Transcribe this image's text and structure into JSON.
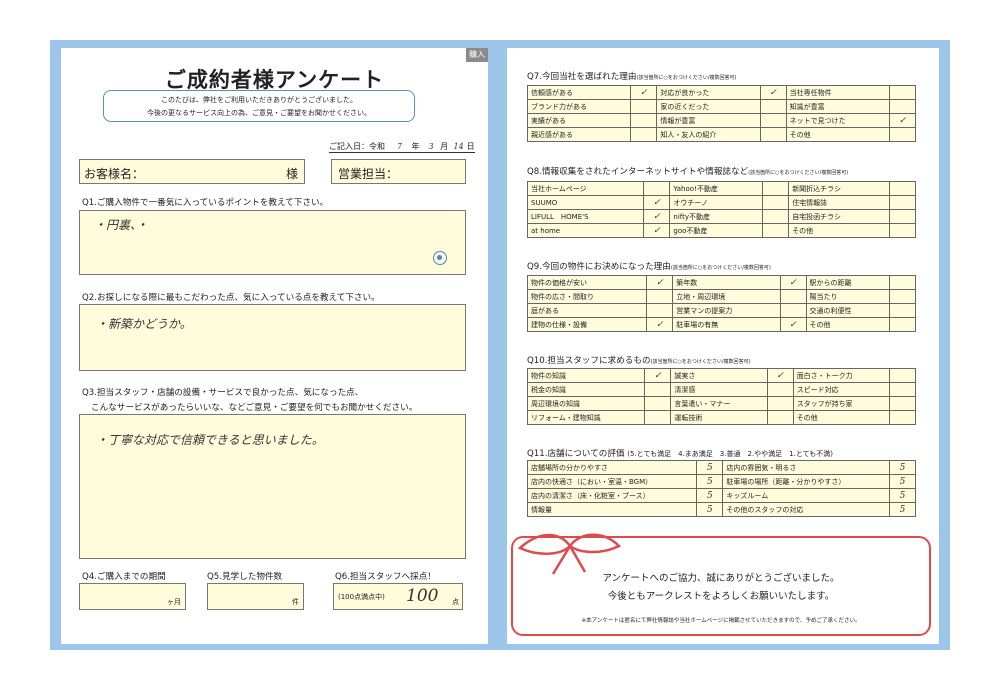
{
  "left": {
    "tag": "購入",
    "title": "ご成約者様アンケート",
    "intro_line1": "このたびは、弊社をご利用いただきありがとうございました。",
    "intro_line2": "今後の更なるサービス向上の為、ご意見・ご要望をお聞かせください。",
    "date_label": "ご記入日：令和",
    "date_year": "7",
    "date_year_unit": "年",
    "date_month": "3",
    "date_month_unit": "月",
    "date_day": "14",
    "date_day_unit": "日",
    "customer_label": "お客様名：",
    "customer_suffix": "様",
    "staff_label": "営業担当：",
    "q1": "Q1.ご購入物件で一番気に入っているポイントを教えて下さい。",
    "q1_answer": "・円裏、・",
    "q2": "Q2.お探しになる際に最もこだわった点、気に入っている点を教えて下さい。",
    "q2_answer": "・新築かどうか。",
    "q3_line1": "Q3.担当スタッフ・店舗の設備・サービスで良かった点、気になった点、",
    "q3_line2": "こんなサービスがあったらいいな、などご意見・ご要望を何でもお聞かせください。",
    "q3_answer": "・丁寧な対応で信頼できると思いました。",
    "q4": "Q4.ご購入までの期間",
    "q4_unit": "ヶ月",
    "q5": "Q5.見学した物件数",
    "q5_unit": "件",
    "q6": "Q6.担当スタッフへ採点！",
    "q6_prefix": "(100点満点中)",
    "q6_score": "100",
    "q6_unit": "点"
  },
  "right": {
    "q7": "Q7.今回当社を選ばれた理由",
    "q7_note": "(該当箇所に○をおつけください/複数回答可)",
    "q7_rows": [
      [
        "信頼感がある",
        "✓",
        "対応が良かった",
        "✓",
        "当社専任物件",
        ""
      ],
      [
        "ブランド力がある",
        "",
        "家の近くだった",
        "",
        "知識が豊富",
        ""
      ],
      [
        "実績がある",
        "",
        "情報が豊富",
        "",
        "ネットで見つけた",
        "✓"
      ],
      [
        "親近感がある",
        "",
        "知人・友人の紹介",
        "",
        "その他",
        ""
      ]
    ],
    "q8": "Q8.情報収集をされたインターネットサイトや情報誌など",
    "q8_note": "(該当箇所に○をおつけください/複数回答可)",
    "q8_rows": [
      [
        "当社ホームページ",
        "",
        "Yahoo!不動産",
        "",
        "新聞折込チラシ",
        ""
      ],
      [
        "SUUMO",
        "✓",
        "オウチーノ",
        "",
        "住宅情報誌",
        ""
      ],
      [
        "LIFULL　HOME'S",
        "✓",
        "nifty不動産",
        "",
        "自宅投函チラシ",
        ""
      ],
      [
        "at home",
        "✓",
        "goo不動産",
        "",
        "その他",
        ""
      ]
    ],
    "q9": "Q9.今回の物件にお決めになった理由",
    "q9_note": "(該当箇所に○をおつけください/複数回答可)",
    "q9_rows": [
      [
        "物件の価格が安い",
        "✓",
        "築年数",
        "✓",
        "駅からの距離",
        ""
      ],
      [
        "物件の広さ・間取り",
        "",
        "立地・周辺環境",
        "",
        "陽当たり",
        ""
      ],
      [
        "庭がある",
        "",
        "営業マンの提案力",
        "",
        "交通の利便性",
        ""
      ],
      [
        "建物の仕様・設備",
        "✓",
        "駐車場の有無",
        "✓",
        "その他",
        ""
      ]
    ],
    "q10": "Q10.担当スタッフに求めるもの",
    "q10_note": "(該当箇所に○をおつけください/複数回答可)",
    "q10_rows": [
      [
        "物件の知識",
        "✓",
        "誠実さ",
        "✓",
        "面白さ・トーク力",
        ""
      ],
      [
        "税金の知識",
        "",
        "清潔感",
        "",
        "スピード対応",
        ""
      ],
      [
        "周辺環境の知識",
        "",
        "言葉遣い・マナー",
        "",
        "スタッフが持ち家",
        ""
      ],
      [
        "リフォーム・建物知識",
        "",
        "運転技術",
        "",
        "その他",
        ""
      ]
    ],
    "q11": "Q11.店舗についての評価",
    "q11_scale": "(5.とても満足　4.まあ満足　3.普通　2.やや満足　1.とても不満)",
    "q11_rows": [
      [
        "店舗場所の分かりやすさ",
        "5",
        "店内の雰囲気・明るさ",
        "5"
      ],
      [
        "店内の快適さ（におい・室温・BGM）",
        "5",
        "駐車場の場所（距離・分かりやすさ）",
        "5"
      ],
      [
        "店内の清潔さ（床・化粧室・ブース）",
        "5",
        "キッズルーム",
        "5"
      ],
      [
        "情報量",
        "5",
        "その他のスタッフの対応",
        "5"
      ]
    ],
    "thanks_line1": "アンケートへのご協力、誠にありがとうございました。",
    "thanks_line2": "今後ともアークレストをよろしくお願いいたします。",
    "note": "※本アンケートは匿名にて弊社情報誌や当社ホームページに掲載させていただきますので、予めご了承ください。",
    "ribbon_color": "#e04a4a"
  },
  "accent_color": "#9cc7ea"
}
